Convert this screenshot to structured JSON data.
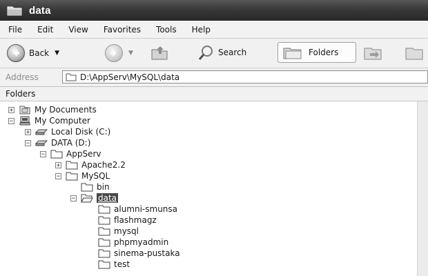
{
  "window": {
    "title": "data"
  },
  "menu": [
    "File",
    "Edit",
    "View",
    "Favorites",
    "Tools",
    "Help"
  ],
  "toolbar": {
    "back_label": "Back",
    "search_label": "Search",
    "folders_label": "Folders"
  },
  "address": {
    "label": "Address",
    "value": "D:\\AppServ\\MySQL\\data"
  },
  "pane": {
    "title": "Folders"
  },
  "tree": {
    "my_documents": "My Documents",
    "my_computer": "My Computer",
    "local_disk": "Local Disk (C:)",
    "data_drive": "DATA (D:)",
    "appserv": "AppServ",
    "apache": "Apache2.2",
    "mysql": "MySQL",
    "bin": "bin",
    "data": "data",
    "children": [
      "alumni-smunsa",
      "flashmagz",
      "mysql",
      "phpmyadmin",
      "sinema-pustaka",
      "test"
    ]
  },
  "selected_folder": "data"
}
